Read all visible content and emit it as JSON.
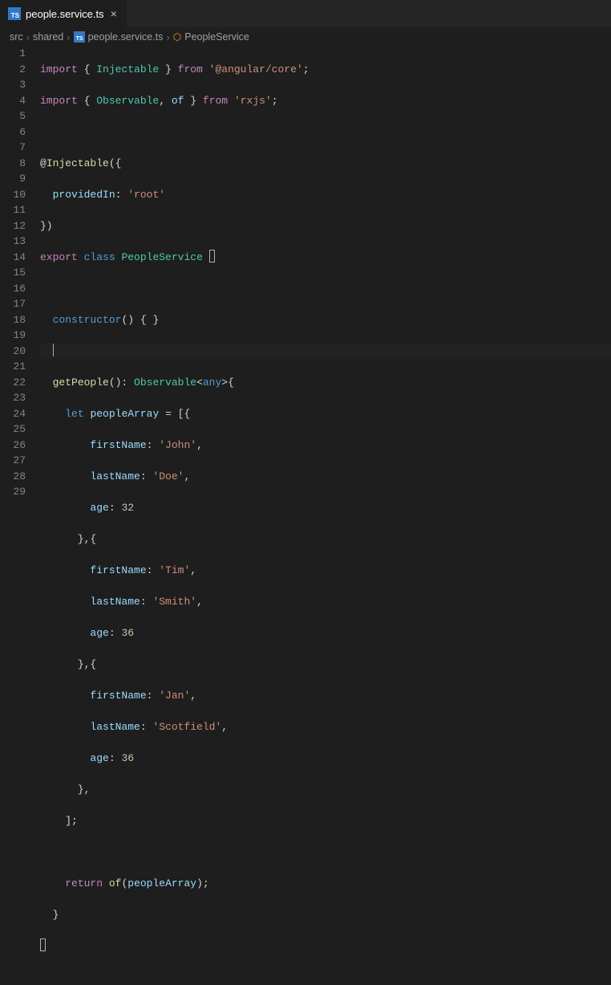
{
  "tab": {
    "label": "people.service.ts",
    "icon_text": "TS"
  },
  "breadcrumbs": {
    "items": [
      "src",
      "shared",
      "people.service.ts",
      "PeopleService"
    ],
    "file_icon_text": "TS"
  },
  "gutter": {
    "start": 1,
    "end": 29
  },
  "code": {
    "l1_import": "import",
    "l1_b1": " { ",
    "l1_Injectable": "Injectable",
    "l1_b2": " } ",
    "l1_from": "from",
    "l1_mod": " '@angular/core'",
    "l1_semi": ";",
    "l2_import": "import",
    "l2_b1": " { ",
    "l2_Observable": "Observable",
    "l2_c": ", ",
    "l2_of": "of",
    "l2_b2": " } ",
    "l2_from": "from",
    "l2_mod": " 'rxjs'",
    "l2_semi": ";",
    "l4_deco": "@",
    "l4_Injectable": "Injectable",
    "l4_p": "({",
    "l5_pad": "  ",
    "l5_providedIn": "providedIn",
    "l5_c": ": ",
    "l5_val": "'root'",
    "l6_close": "})",
    "l7_export": "export",
    "l7_sp": " ",
    "l7_class": "class",
    "l7_sp2": " ",
    "l7_name": "PeopleService",
    "l7_sp3": " ",
    "l9_pad": "  ",
    "l9_ctor": "constructor",
    "l9_body": "() { }",
    "l10_pad": "  ",
    "l11_pad": "  ",
    "l11_fn": "getPeople",
    "l11_paren": "(): ",
    "l11_type": "Observable",
    "l11_lt": "<",
    "l11_any": "any",
    "l11_gt": ">{",
    "l12_pad": "    ",
    "l12_let": "let",
    "l12_sp": " ",
    "l12_var": "peopleArray",
    "l12_eq": " = [{",
    "l13_pad": "        ",
    "l13_k": "firstName",
    "l13_c": ": ",
    "l13_v": "'John'",
    "l13_comma": ",",
    "l14_pad": "        ",
    "l14_k": "lastName",
    "l14_c": ": ",
    "l14_v": "'Doe'",
    "l14_comma": ",",
    "l15_pad": "        ",
    "l15_k": "age",
    "l15_c": ": ",
    "l15_v": "32",
    "l16_pad": "      },{",
    "l17_pad": "        ",
    "l17_k": "firstName",
    "l17_c": ": ",
    "l17_v": "'Tim'",
    "l17_comma": ",",
    "l18_pad": "        ",
    "l18_k": "lastName",
    "l18_c": ": ",
    "l18_v": "'Smith'",
    "l18_comma": ",",
    "l19_pad": "        ",
    "l19_k": "age",
    "l19_c": ": ",
    "l19_v": "36",
    "l20_pad": "      },{",
    "l21_pad": "        ",
    "l21_k": "firstName",
    "l21_c": ": ",
    "l21_v": "'Jan'",
    "l21_comma": ",",
    "l22_pad": "        ",
    "l22_k": "lastName",
    "l22_c": ": ",
    "l22_v": "'Scotfield'",
    "l22_comma": ",",
    "l23_pad": "        ",
    "l23_k": "age",
    "l23_c": ": ",
    "l23_v": "36",
    "l24_pad": "      },",
    "l25_pad": "    ];",
    "l27_pad": "    ",
    "l27_ret": "return",
    "l27_sp": " ",
    "l27_of": "of",
    "l27_p1": "(",
    "l27_arg": "peopleArray",
    "l27_p2": ");",
    "l28_pad": "  }"
  }
}
